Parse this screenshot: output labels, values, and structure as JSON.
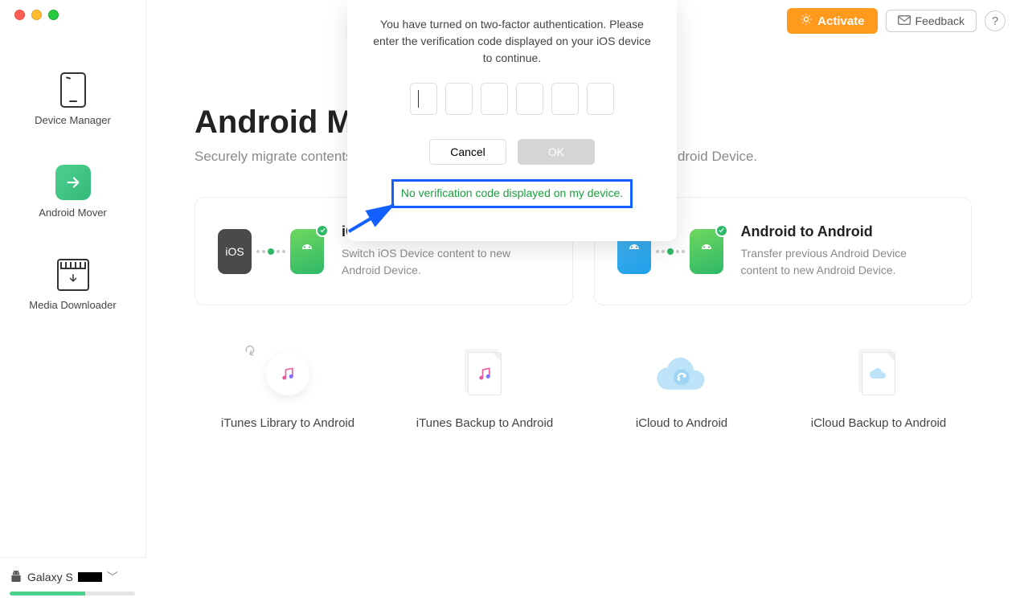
{
  "sidebar": {
    "items": [
      {
        "label": "Device Manager"
      },
      {
        "label": "Android Mover"
      },
      {
        "label": "Media Downloader"
      }
    ]
  },
  "topActions": {
    "activate": "Activate",
    "feedback": "Feedback"
  },
  "main": {
    "title": "Android Mover",
    "subtitle": "Securely migrate contents from iOS Device, Android Device or iCloud to new Android Device.",
    "cards": [
      {
        "title": "iOS to Android",
        "desc": "Switch iOS Device content to new Android Device."
      },
      {
        "title": "Android to Android",
        "desc": "Transfer previous Android Device content to new Android Device."
      }
    ],
    "options": [
      {
        "label": "iTunes Library to Android"
      },
      {
        "label": "iTunes Backup to Android"
      },
      {
        "label": "iCloud to Android"
      },
      {
        "label": "iCloud Backup to Android"
      }
    ]
  },
  "modal": {
    "message": "You have turned on two-factor authentication. Please enter the verification code displayed on your iOS device to continue.",
    "cancel": "Cancel",
    "ok": "OK",
    "linkText": "No verification code displayed on my device."
  },
  "device": {
    "prefix": "Galaxy S",
    "progressPct": 60
  }
}
